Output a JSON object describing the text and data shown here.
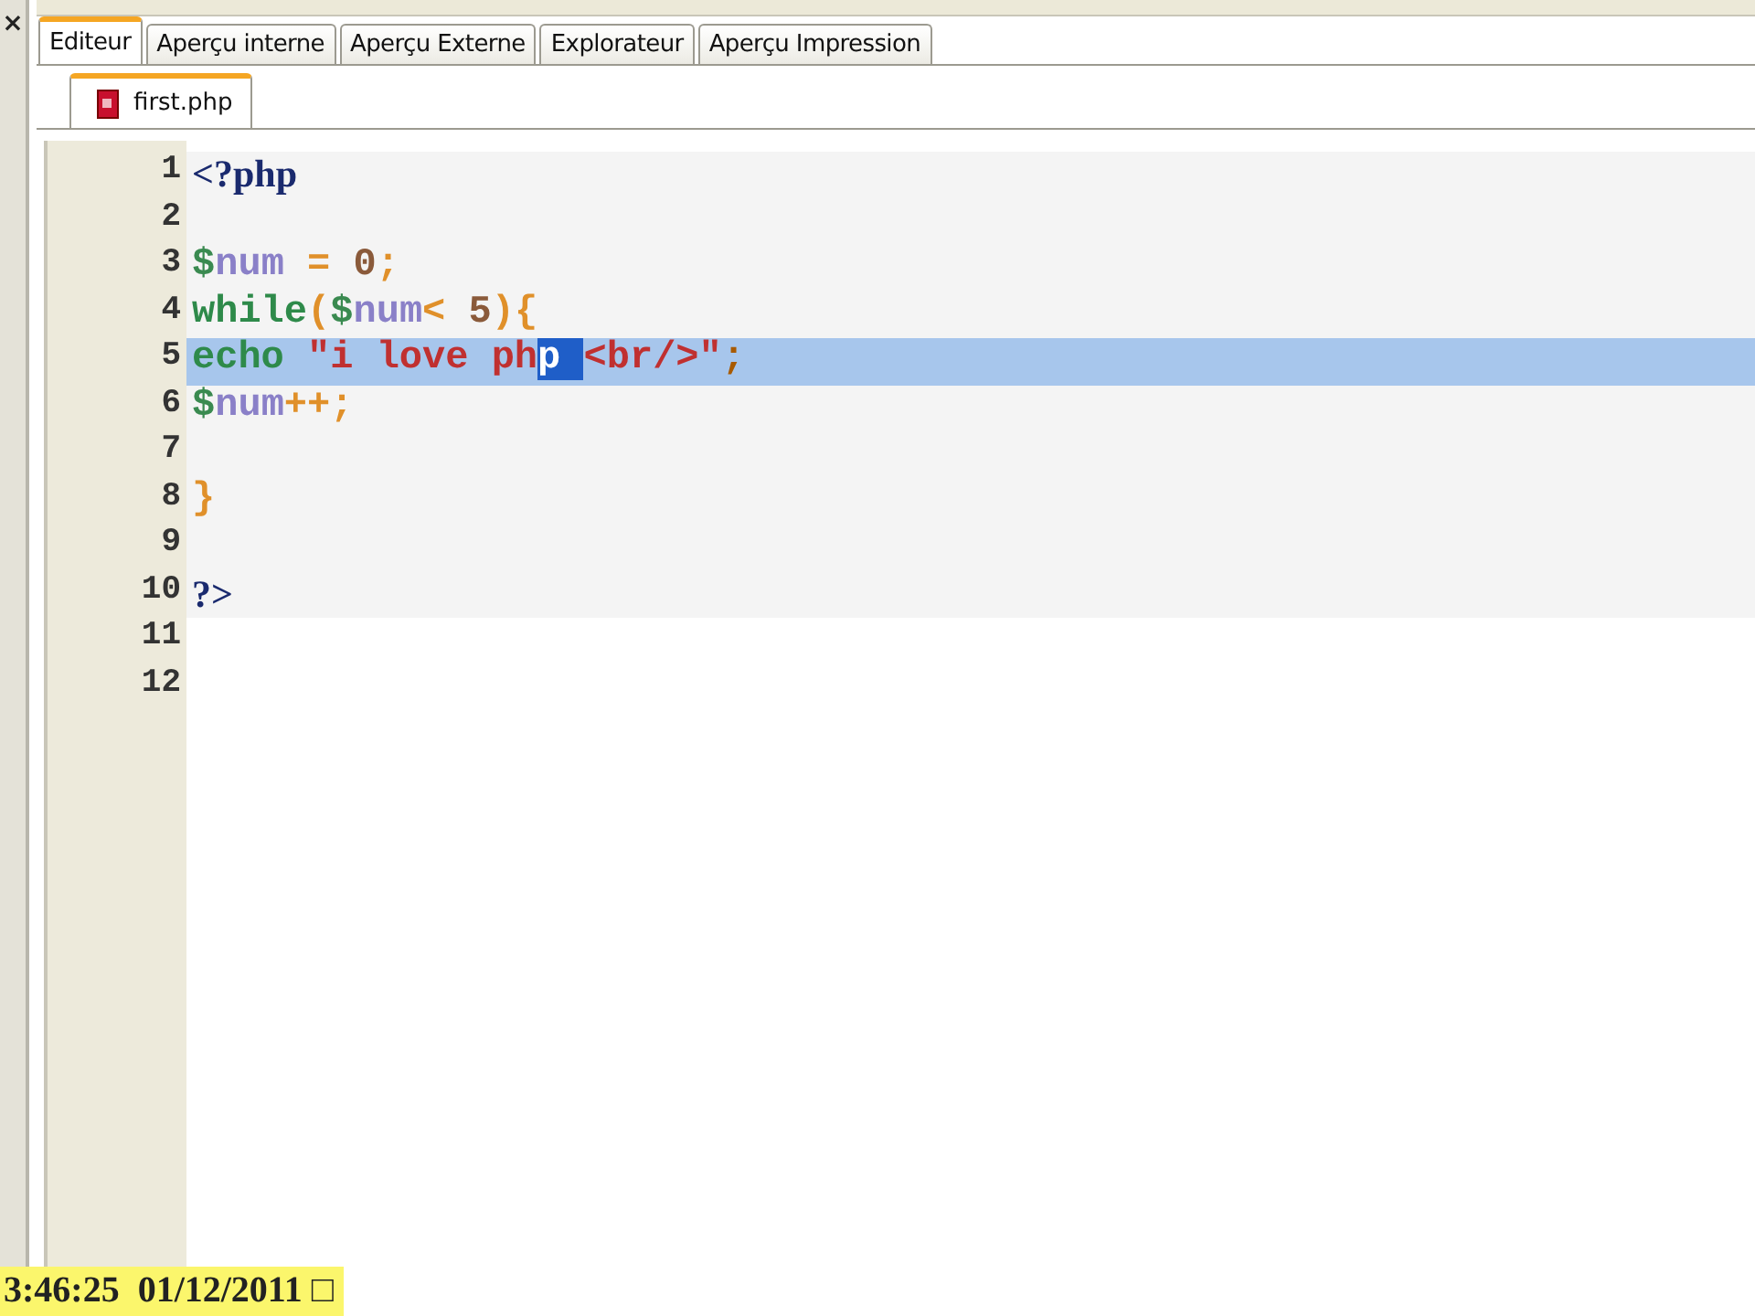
{
  "side_panel": {
    "close_glyph": "×"
  },
  "view_tabs": [
    {
      "label": "Editeur",
      "selected": true
    },
    {
      "label": "Aperçu interne",
      "selected": false
    },
    {
      "label": "Aperçu Externe",
      "selected": false
    },
    {
      "label": "Explorateur",
      "selected": false
    },
    {
      "label": "Aperçu Impression",
      "selected": false
    }
  ],
  "file_tabs": [
    {
      "label": "first.php",
      "selected": true
    }
  ],
  "editor": {
    "lines": [
      {
        "number": "1",
        "highlighted": false,
        "tokens": [
          {
            "kind": "tag",
            "text": "<?php"
          }
        ]
      },
      {
        "number": "2",
        "highlighted": false
      },
      {
        "number": "3",
        "highlighted": false,
        "tokens": [
          {
            "kind": "dollar",
            "text": "$"
          },
          {
            "kind": "variable",
            "text": "num"
          },
          {
            "kind": "operator",
            "text": " = "
          },
          {
            "kind": "number",
            "text": "0"
          },
          {
            "kind": "operator",
            "text": ";"
          }
        ]
      },
      {
        "number": "4",
        "highlighted": false,
        "tokens": [
          {
            "kind": "keyword",
            "text": "while"
          },
          {
            "kind": "operator",
            "text": "("
          },
          {
            "kind": "dollar",
            "text": "$"
          },
          {
            "kind": "variable",
            "text": "num"
          },
          {
            "kind": "operator",
            "text": "< "
          },
          {
            "kind": "number",
            "text": "5"
          },
          {
            "kind": "operator",
            "text": "){"
          }
        ]
      },
      {
        "number": "5",
        "highlighted": true,
        "tokens": [
          {
            "kind": "keyword",
            "text": "echo "
          },
          {
            "kind": "string",
            "text": "\"i love ph"
          },
          {
            "kind": "selection",
            "text": "p "
          },
          {
            "kind": "string",
            "text": "<br/>\""
          },
          {
            "kind": "operator",
            "text": ";"
          }
        ]
      },
      {
        "number": "6",
        "highlighted": false,
        "tokens": [
          {
            "kind": "dollar",
            "text": "$"
          },
          {
            "kind": "variable",
            "text": "num"
          },
          {
            "kind": "operator",
            "text": "++;"
          }
        ]
      },
      {
        "number": "7",
        "highlighted": false
      },
      {
        "number": "8",
        "highlighted": false,
        "tokens": [
          {
            "kind": "operator",
            "text": "}"
          }
        ]
      },
      {
        "number": "9",
        "highlighted": false
      },
      {
        "number": "10",
        "highlighted": false,
        "tokens": [
          {
            "kind": "tag",
            "text": "?>"
          }
        ]
      },
      {
        "number": "11",
        "highlighted": false
      },
      {
        "number": "12",
        "highlighted": false
      }
    ]
  },
  "timestamp": "3:46:25  01/12/2011 □"
}
